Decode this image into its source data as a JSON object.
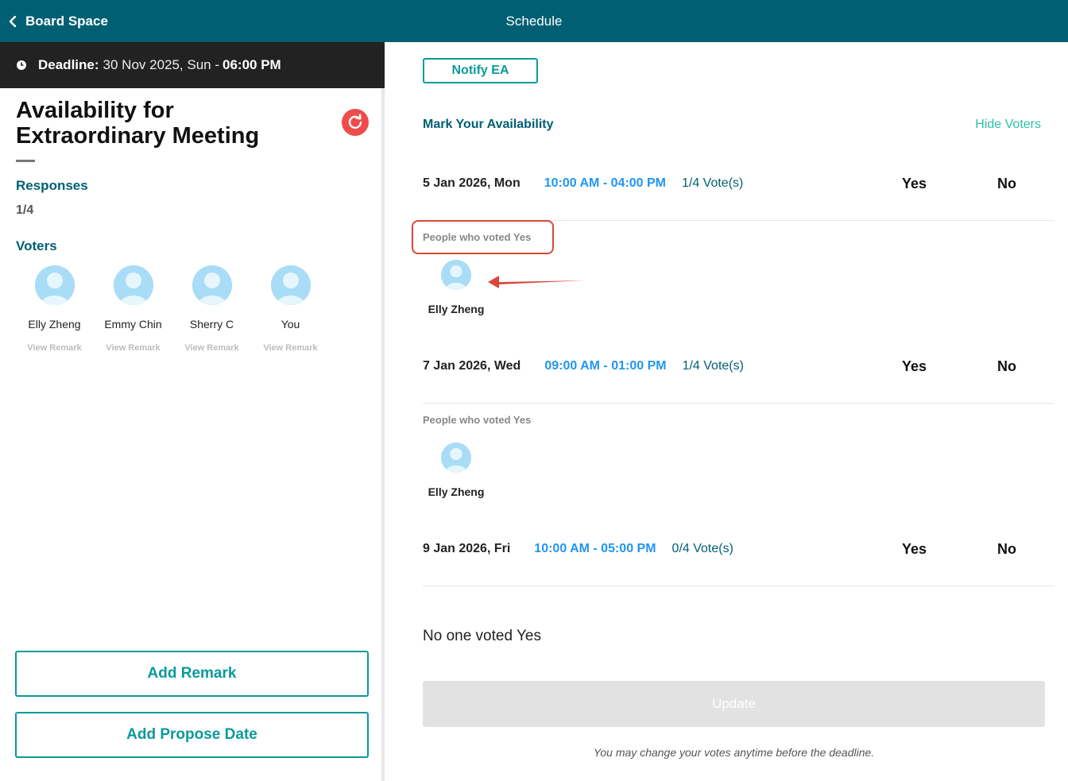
{
  "topbar": {
    "back_label": "Board Space",
    "title": "Schedule",
    "color": "#005f73"
  },
  "deadline": {
    "label": "Deadline:",
    "date": "30 Nov 2025, Sun -",
    "time": "06:00 PM"
  },
  "meeting": {
    "title": "Availability for Extraordinary Meeting"
  },
  "responses": {
    "label": "Responses",
    "value": "1/4"
  },
  "voters": {
    "label": "Voters",
    "items": [
      {
        "name": "Elly Zheng",
        "remark": "View Remark"
      },
      {
        "name": "Emmy Chin",
        "remark": "View Remark"
      },
      {
        "name": "Sherry C",
        "remark": "View Remark"
      },
      {
        "name": "You",
        "remark": "View Remark"
      }
    ]
  },
  "buttons": {
    "add_remark": "Add Remark",
    "add_propose_date": "Add Propose Date",
    "notify_ea": "Notify EA",
    "update": "Update"
  },
  "availability": {
    "title": "Mark Your Availability",
    "hide_voters": "Hide Voters",
    "slots": [
      {
        "date": "5 Jan 2026, Mon",
        "time": "10:00 AM - 04:00 PM",
        "votes": "1/4 Vote(s)",
        "yes": "Yes",
        "no": "No",
        "voted_label": "People who voted Yes",
        "voter": "Elly Zheng"
      },
      {
        "date": "7 Jan 2026, Wed",
        "time": "09:00 AM - 01:00 PM",
        "votes": "1/4 Vote(s)",
        "yes": "Yes",
        "no": "No",
        "voted_label": "People who voted Yes",
        "voter": "Elly Zheng"
      },
      {
        "date": "9 Jan 2026, Fri",
        "time": "10:00 AM - 05:00 PM",
        "votes": "0/4 Vote(s)",
        "yes": "Yes",
        "no": "No",
        "empty": "No one voted Yes"
      }
    ],
    "hint": "You may change your votes anytime before the deadline."
  },
  "colors": {
    "accent": "#0a9a9a",
    "time": "#2196f3",
    "highlight": "#d9473b",
    "refresh": "#ef4b4b"
  }
}
